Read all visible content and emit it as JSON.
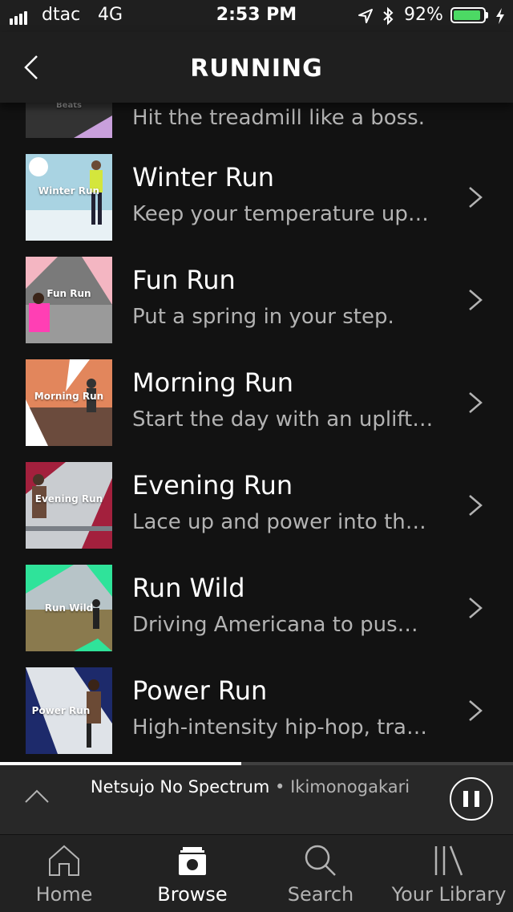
{
  "status_bar": {
    "carrier": "dtac",
    "network": "4G",
    "time": "2:53 PM",
    "battery_percent": "92%",
    "battery_level": 0.92
  },
  "header": {
    "title": "RUNNING"
  },
  "partial_row": {
    "desc": "Hit the treadmill like a boss.",
    "thumb_label": "Beats"
  },
  "playlists": [
    {
      "name": "Winter Run",
      "desc": "Keep your temperature up…",
      "thumb_label": "Winter Run"
    },
    {
      "name": "Fun Run",
      "desc": "Put a spring in your step.",
      "thumb_label": "Fun Run"
    },
    {
      "name": "Morning Run",
      "desc": "Start the day with an uplift…",
      "thumb_label": "Morning Run"
    },
    {
      "name": "Evening Run",
      "desc": "Lace up and power into th…",
      "thumb_label": "Evening Run"
    },
    {
      "name": "Run Wild",
      "desc": "Driving Americana to pus…",
      "thumb_label": "Run Wild"
    },
    {
      "name": "Power Run",
      "desc": "High-intensity hip-hop, tra…",
      "thumb_label": "Power Run"
    }
  ],
  "now_playing": {
    "track": "Netsujo No Spectrum",
    "separator": " • ",
    "artist": "Ikimonogakari",
    "progress": 0.47
  },
  "tabs": [
    {
      "label": "Home",
      "icon": "home-icon"
    },
    {
      "label": "Browse",
      "icon": "browse-icon",
      "active": true
    },
    {
      "label": "Search",
      "icon": "search-icon"
    },
    {
      "label": "Your Library",
      "icon": "library-icon"
    }
  ],
  "colors": {
    "accent_green": "#4cd964",
    "background": "#121212",
    "bar": "#1f1f1f"
  }
}
